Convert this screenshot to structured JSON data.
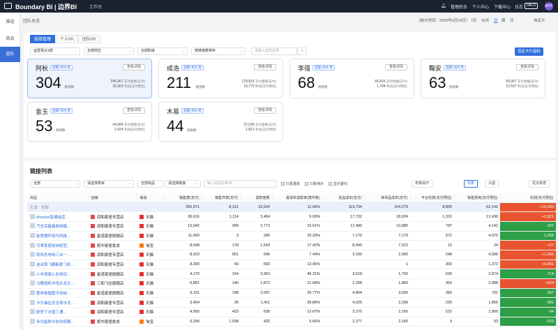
{
  "top": {
    "brand": "Boundary BI | 边界BI",
    "workspace": "工作台",
    "items": [
      "管理后台",
      "个人中心",
      "下载中心",
      "日志"
    ],
    "badge": "VALI1",
    "avatar": "BHT"
  },
  "side": {
    "items": [
      "渠道",
      "商品",
      "团队"
    ]
  },
  "crumb": "团队总览",
  "period": {
    "label": "（统计时间：2025年5月18日）",
    "options": [
      "7天",
      "30天",
      "日",
      "周",
      "月"
    ],
    "custom": "自定义"
  },
  "tabs": [
    "链接管理",
    "个人PK",
    "团队PK"
  ],
  "filters": {
    "d1": "运营事业1部",
    "d2": "全部岗位",
    "d3": "全部职级",
    "d4": "按链接数排序",
    "search_placeholder": "请输入成员名称",
    "kanban_btn": "设定卡片指标"
  },
  "card_labels": {
    "detail": "查看详情",
    "tenure": "在职 414 天",
    "links": "链接数",
    "gmv_label": "支付金额(支付)",
    "profit_label": "利润(支付预估)"
  },
  "cards": [
    {
      "name": "阿秋",
      "count": "304",
      "gmv": "245,967",
      "profit": "16,363",
      "hl": true
    },
    {
      "name": "成浩",
      "count": "211",
      "gmv": "178,814",
      "profit": "10,770",
      "hl": false
    },
    {
      "name": "李强",
      "count": "68",
      "gmv": "66,816",
      "profit": "1,794",
      "hl": false
    },
    {
      "name": "鞠安",
      "count": "63",
      "gmv": "50,907",
      "profit": "12,537",
      "hl": false
    },
    {
      "name": "金玉",
      "count": "53",
      "gmv": "44,684",
      "profit": "2,424",
      "hl": false
    },
    {
      "name": "木易",
      "count": "44",
      "gmv": "37,030",
      "profit": "1,821",
      "hl": false
    }
  ],
  "list": {
    "title": "链接列表",
    "f1": "全部",
    "f2": "请选择类目",
    "f3": "全部商品",
    "f4": "请选择链接",
    "search_placeholder": "输入商品名称/ID",
    "checks": [
      "只看潜进",
      "只看待办",
      "显示置句"
    ],
    "btns": [
      "表格操作",
      "列表",
      "大图",
      "更多数据"
    ]
  },
  "table": {
    "headers": [
      "商品",
      "店铺",
      "渠道",
      "销售额(支付)",
      "销售件数(支付)",
      "退款金额",
      "最请单退款率(按件数)",
      "货品成本(支付)",
      "净货品成本(支付)",
      "平台花费(支付预估)",
      "销售费用(支付预估)",
      "利润(支付预估)"
    ],
    "summary": [
      "汇总 · 全部",
      "",
      "",
      "206,971",
      "8,131",
      "32,624",
      "11.06%",
      "119,734",
      "104,279",
      "8,800",
      "62,142",
      "+16,363"
    ],
    "rows": [
      [
        "Mocbbe智通遥控…",
        "润和家居专营店",
        "天猫",
        "36,616",
        "1,114",
        "3,454",
        "9.09%",
        "17,732",
        "18,924",
        "1,310",
        "12,430",
        "+2,821"
      ],
      [
        "汽车后备箱收纳箱…",
        "润和家居专营店",
        "天猫",
        "15,642",
        "269",
        "2,773",
        "15.61%",
        "12,480",
        "10,880",
        "797",
        "4,142",
        "-327"
      ],
      [
        "新房摆件现代风格…",
        "星诺家居旗舰店",
        "天猫",
        "11,660",
        "3",
        "280",
        "33.33%",
        "7,170",
        "7,170",
        "671",
        "4,975",
        "-2,359"
      ],
      [
        "可拿家庭收纳柜型…",
        "妮中家居批发",
        "淘宝",
        "8,048",
        "178",
        "1,543",
        "17.42%",
        "8,945",
        "7,522",
        "12",
        "24",
        "+27"
      ],
      [
        "和风色电线三合一…",
        "润和家居专营店",
        "天猫",
        "8,910",
        "551",
        "645",
        "7.44%",
        "3,160",
        "2,990",
        "248",
        "4,096",
        "+1,003"
      ],
      [
        "迷试周飞翻新款飞机…",
        "润和家居专营店",
        "天猫",
        "8,390",
        "43",
        "650",
        "13.95%",
        "",
        "1",
        "300",
        "1,373",
        "+6,801"
      ],
      [
        "小羊哥客心女用创…",
        "星诺家居旗舰店",
        "天猫",
        "4,170",
        "154",
        "3,953",
        "46.31%",
        "3,518",
        "1,750",
        "639",
        "2,874",
        "-714"
      ],
      [
        "马桶增粉冲洗水龙头…",
        "三和飞达旗舰店",
        "天猫",
        "5,851",
        "146",
        "1,872",
        "21.68%",
        "2,258",
        "1,860",
        "353",
        "2,988",
        "+524"
      ],
      [
        "整体拖箱整平收纳…",
        "星诺家居旗舰店",
        "天猫",
        "5,151",
        "198",
        "2,097",
        "26.77%",
        "4,864",
        "3,595",
        "283",
        "731",
        "-367"
      ],
      [
        "卡贝抽拉式全铜水龙…",
        "润和家居专营店",
        "天猫",
        "3,454",
        "26",
        "1,411",
        "38.89%",
        "4,025",
        "2,296",
        "225",
        "1,856",
        "-991"
      ],
      [
        "厨房下水管三通…",
        "润和家居专营店",
        "天猫",
        "4,950",
        "423",
        "630",
        "12.67%",
        "2,270",
        "2,160",
        "515",
        "1,950",
        "-54"
      ],
      [
        "多功能刷卡防伪纸藏…",
        "妮中家居批发",
        "淘宝",
        "6,256",
        "1,938",
        "432",
        "6.66%",
        "2,277",
        "2,160",
        "4",
        "93",
        "-519"
      ]
    ],
    "profit_colors": [
      "#e8542f",
      "#e8542f",
      "#2e9e47",
      "#2e9e47",
      "#e8542f",
      "#e8542f",
      "#e8542f",
      "#2e9e47",
      "#e8542f",
      "#2e9e47",
      "#2e9e47",
      "#2e9e47",
      "#2e9e47"
    ]
  }
}
